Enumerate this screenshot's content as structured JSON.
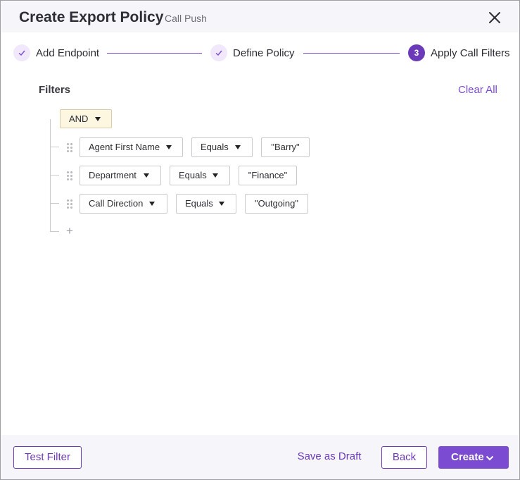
{
  "dialog": {
    "title": "Create Export Policy",
    "subtitle": "Call Push"
  },
  "stepper": {
    "steps": [
      {
        "label": "Add Endpoint",
        "state": "done"
      },
      {
        "label": "Define Policy",
        "state": "done"
      },
      {
        "label": "Apply Call Filters",
        "state": "active",
        "number": "3"
      }
    ]
  },
  "filters": {
    "title": "Filters",
    "clear_all": "Clear All",
    "operator": "AND",
    "rules": [
      {
        "field": "Agent First Name",
        "comparator": "Equals",
        "value": "\"Barry\""
      },
      {
        "field": "Department",
        "comparator": "Equals",
        "value": "\"Finance\""
      },
      {
        "field": "Call Direction",
        "comparator": "Equals",
        "value": "\"Outgoing\""
      }
    ],
    "add_symbol": "+"
  },
  "footer": {
    "test_filter": "Test Filter",
    "save_draft": "Save as Draft",
    "back": "Back",
    "create": "Create"
  },
  "colors": {
    "accent": "#7b4bd1",
    "accent_dark": "#6b3ab8",
    "header_bg": "#f6f6fa",
    "and_bg": "#fdf6e1"
  }
}
